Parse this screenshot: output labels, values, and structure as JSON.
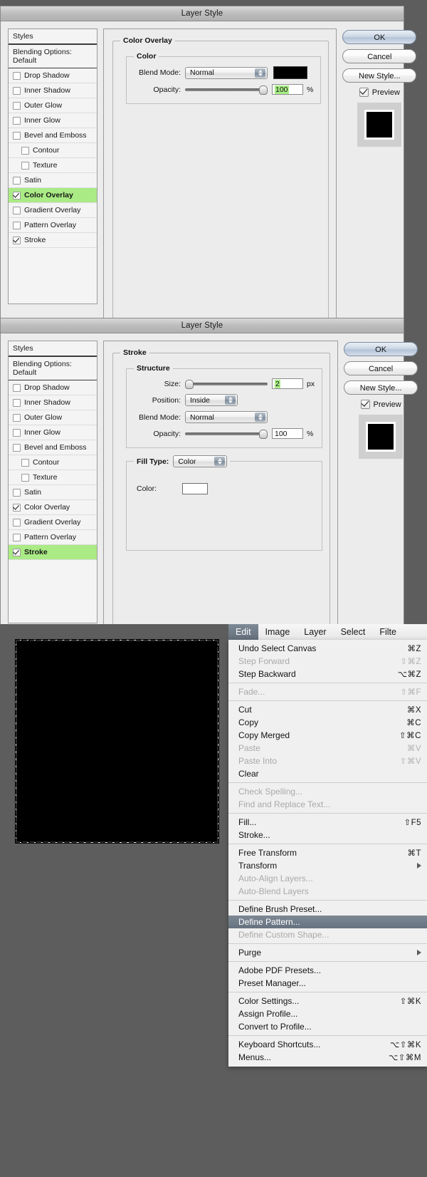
{
  "dialog1": {
    "title": "Layer Style",
    "styles_header": "Styles",
    "blending_options": "Blending Options: Default",
    "style_items": [
      {
        "label": "Drop Shadow",
        "checked": false,
        "indent": false,
        "active": false
      },
      {
        "label": "Inner Shadow",
        "checked": false,
        "indent": false,
        "active": false
      },
      {
        "label": "Outer Glow",
        "checked": false,
        "indent": false,
        "active": false
      },
      {
        "label": "Inner Glow",
        "checked": false,
        "indent": false,
        "active": false
      },
      {
        "label": "Bevel and Emboss",
        "checked": false,
        "indent": false,
        "active": false
      },
      {
        "label": "Contour",
        "checked": false,
        "indent": true,
        "active": false
      },
      {
        "label": "Texture",
        "checked": false,
        "indent": true,
        "active": false
      },
      {
        "label": "Satin",
        "checked": false,
        "indent": false,
        "active": false
      },
      {
        "label": "Color Overlay",
        "checked": true,
        "indent": false,
        "active": true
      },
      {
        "label": "Gradient Overlay",
        "checked": false,
        "indent": false,
        "active": false
      },
      {
        "label": "Pattern Overlay",
        "checked": false,
        "indent": false,
        "active": false
      },
      {
        "label": "Stroke",
        "checked": true,
        "indent": false,
        "active": false
      }
    ],
    "panel": {
      "group_title": "Color Overlay",
      "sub_title": "Color",
      "blend_mode_label": "Blend Mode:",
      "blend_mode_value": "Normal",
      "color_swatch": "#000000",
      "opacity_label": "Opacity:",
      "opacity_value": "100",
      "opacity_unit": "%"
    },
    "buttons": {
      "ok": "OK",
      "cancel": "Cancel",
      "new_style": "New Style...",
      "preview_label": "Preview",
      "preview_checked": true
    }
  },
  "dialog2": {
    "title": "Layer Style",
    "styles_header": "Styles",
    "blending_options": "Blending Options: Default",
    "style_items": [
      {
        "label": "Drop Shadow",
        "checked": false,
        "indent": false,
        "active": false
      },
      {
        "label": "Inner Shadow",
        "checked": false,
        "indent": false,
        "active": false
      },
      {
        "label": "Outer Glow",
        "checked": false,
        "indent": false,
        "active": false
      },
      {
        "label": "Inner Glow",
        "checked": false,
        "indent": false,
        "active": false
      },
      {
        "label": "Bevel and Emboss",
        "checked": false,
        "indent": false,
        "active": false
      },
      {
        "label": "Contour",
        "checked": false,
        "indent": true,
        "active": false
      },
      {
        "label": "Texture",
        "checked": false,
        "indent": true,
        "active": false
      },
      {
        "label": "Satin",
        "checked": false,
        "indent": false,
        "active": false
      },
      {
        "label": "Color Overlay",
        "checked": true,
        "indent": false,
        "active": false
      },
      {
        "label": "Gradient Overlay",
        "checked": false,
        "indent": false,
        "active": false
      },
      {
        "label": "Pattern Overlay",
        "checked": false,
        "indent": false,
        "active": false
      },
      {
        "label": "Stroke",
        "checked": true,
        "indent": false,
        "active": true
      }
    ],
    "panel": {
      "group_title": "Stroke",
      "sub_title": "Structure",
      "size_label": "Size:",
      "size_value": "2",
      "size_unit": "px",
      "position_label": "Position:",
      "position_value": "Inside",
      "blend_mode_label": "Blend Mode:",
      "blend_mode_value": "Normal",
      "opacity_label": "Opacity:",
      "opacity_value": "100",
      "opacity_unit": "%",
      "fill_type_label": "Fill Type:",
      "fill_type_value": "Color",
      "color_label": "Color:",
      "color_swatch": "#ffffff"
    },
    "buttons": {
      "ok": "OK",
      "cancel": "Cancel",
      "new_style": "New Style...",
      "preview_label": "Preview",
      "preview_checked": true
    }
  },
  "workspace": {
    "canvas_fill": "#000000",
    "menubar": [
      {
        "label": "Edit",
        "open": true
      },
      {
        "label": "Image",
        "open": false
      },
      {
        "label": "Layer",
        "open": false
      },
      {
        "label": "Select",
        "open": false
      },
      {
        "label": "Filte",
        "open": false
      }
    ],
    "menu_groups": [
      {
        "items": [
          {
            "label": "Undo Select Canvas",
            "shortcut": "⌘Z",
            "disabled": false,
            "selected": false,
            "submenu": false
          },
          {
            "label": "Step Forward",
            "shortcut": "⇧⌘Z",
            "disabled": true,
            "selected": false,
            "submenu": false
          },
          {
            "label": "Step Backward",
            "shortcut": "⌥⌘Z",
            "disabled": false,
            "selected": false,
            "submenu": false
          }
        ]
      },
      {
        "items": [
          {
            "label": "Fade...",
            "shortcut": "⇧⌘F",
            "disabled": true,
            "selected": false,
            "submenu": false
          }
        ]
      },
      {
        "items": [
          {
            "label": "Cut",
            "shortcut": "⌘X",
            "disabled": false,
            "selected": false,
            "submenu": false
          },
          {
            "label": "Copy",
            "shortcut": "⌘C",
            "disabled": false,
            "selected": false,
            "submenu": false
          },
          {
            "label": "Copy Merged",
            "shortcut": "⇧⌘C",
            "disabled": false,
            "selected": false,
            "submenu": false
          },
          {
            "label": "Paste",
            "shortcut": "⌘V",
            "disabled": true,
            "selected": false,
            "submenu": false
          },
          {
            "label": "Paste Into",
            "shortcut": "⇧⌘V",
            "disabled": true,
            "selected": false,
            "submenu": false
          },
          {
            "label": "Clear",
            "shortcut": "",
            "disabled": false,
            "selected": false,
            "submenu": false
          }
        ]
      },
      {
        "items": [
          {
            "label": "Check Spelling...",
            "shortcut": "",
            "disabled": true,
            "selected": false,
            "submenu": false
          },
          {
            "label": "Find and Replace Text...",
            "shortcut": "",
            "disabled": true,
            "selected": false,
            "submenu": false
          }
        ]
      },
      {
        "items": [
          {
            "label": "Fill...",
            "shortcut": "⇧F5",
            "disabled": false,
            "selected": false,
            "submenu": false
          },
          {
            "label": "Stroke...",
            "shortcut": "",
            "disabled": false,
            "selected": false,
            "submenu": false
          }
        ]
      },
      {
        "items": [
          {
            "label": "Free Transform",
            "shortcut": "⌘T",
            "disabled": false,
            "selected": false,
            "submenu": false
          },
          {
            "label": "Transform",
            "shortcut": "",
            "disabled": false,
            "selected": false,
            "submenu": true
          },
          {
            "label": "Auto-Align Layers...",
            "shortcut": "",
            "disabled": true,
            "selected": false,
            "submenu": false
          },
          {
            "label": "Auto-Blend Layers",
            "shortcut": "",
            "disabled": true,
            "selected": false,
            "submenu": false
          }
        ]
      },
      {
        "items": [
          {
            "label": "Define Brush Preset...",
            "shortcut": "",
            "disabled": false,
            "selected": false,
            "submenu": false
          },
          {
            "label": "Define Pattern...",
            "shortcut": "",
            "disabled": false,
            "selected": true,
            "submenu": false
          },
          {
            "label": "Define Custom Shape...",
            "shortcut": "",
            "disabled": true,
            "selected": false,
            "submenu": false
          }
        ]
      },
      {
        "items": [
          {
            "label": "Purge",
            "shortcut": "",
            "disabled": false,
            "selected": false,
            "submenu": true
          }
        ]
      },
      {
        "items": [
          {
            "label": "Adobe PDF Presets...",
            "shortcut": "",
            "disabled": false,
            "selected": false,
            "submenu": false
          },
          {
            "label": "Preset Manager...",
            "shortcut": "",
            "disabled": false,
            "selected": false,
            "submenu": false
          }
        ]
      },
      {
        "items": [
          {
            "label": "Color Settings...",
            "shortcut": "⇧⌘K",
            "disabled": false,
            "selected": false,
            "submenu": false
          },
          {
            "label": "Assign Profile...",
            "shortcut": "",
            "disabled": false,
            "selected": false,
            "submenu": false
          },
          {
            "label": "Convert to Profile...",
            "shortcut": "",
            "disabled": false,
            "selected": false,
            "submenu": false
          }
        ]
      },
      {
        "items": [
          {
            "label": "Keyboard Shortcuts...",
            "shortcut": "⌥⇧⌘K",
            "disabled": false,
            "selected": false,
            "submenu": false
          },
          {
            "label": "Menus...",
            "shortcut": "⌥⇧⌘M",
            "disabled": false,
            "selected": false,
            "submenu": false
          }
        ]
      }
    ]
  }
}
